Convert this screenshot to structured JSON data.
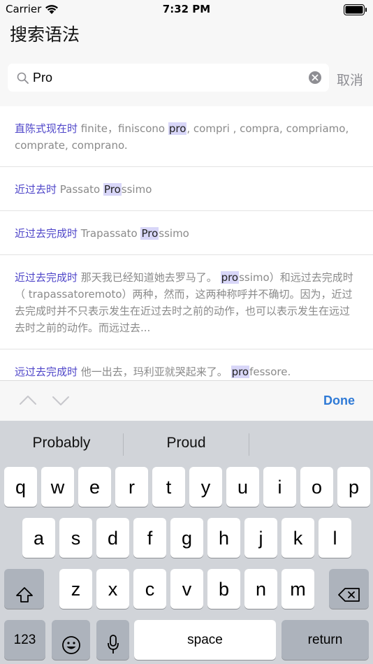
{
  "status": {
    "carrier": "Carrier",
    "time": "7:32 PM"
  },
  "nav": {
    "title": "搜索语法"
  },
  "search": {
    "value": "Pro",
    "cancel_label": "取消"
  },
  "results": [
    {
      "term": "直陈式现在时",
      "before": " finite，finiscono ",
      "match": "pro",
      "after": ", compri , compra, compriamo, comprate, comprano."
    },
    {
      "term": "近过去时",
      "before": " Passato ",
      "match": "Pro",
      "after": "ssimo"
    },
    {
      "term": "近过去完成时",
      "before": " Trapassato ",
      "match": "Pro",
      "after": "ssimo"
    },
    {
      "term": "近过去完成时",
      "before": " 那天我已经知道她去罗马了。 ",
      "match": "pro",
      "after": "ssimo）和远过去完成时（ trapassatoremoto）两种，然而，这两种称呼并不确切。因为，近过去完成时并不只表示发生在近过去时之前的动作，也可以表示发生在远过去时之前的动作。而远过去..."
    },
    {
      "term": "远过去完成时",
      "before": " 他一出去，玛利亚就哭起来了。 ",
      "match": "pro",
      "after": "fessore."
    }
  ],
  "toolbar": {
    "done_label": "Done"
  },
  "keyboard": {
    "suggestions": [
      "Probably",
      "Proud",
      ""
    ],
    "row1": [
      "q",
      "w",
      "e",
      "r",
      "t",
      "y",
      "u",
      "i",
      "o",
      "p"
    ],
    "row2": [
      "a",
      "s",
      "d",
      "f",
      "g",
      "h",
      "j",
      "k",
      "l"
    ],
    "row3": [
      "z",
      "x",
      "c",
      "v",
      "b",
      "n",
      "m"
    ],
    "numbers_label": "123",
    "space_label": "space",
    "return_label": "return"
  },
  "colors": {
    "accent": "#4f46c9",
    "highlight": "#d8d6f8",
    "done": "#2f7ad6"
  },
  "icons": [
    "wifi-icon",
    "battery-icon",
    "search-icon",
    "clear-icon",
    "chevron-up-icon",
    "chevron-down-icon",
    "shift-icon",
    "delete-icon",
    "emoji-icon",
    "microphone-icon"
  ]
}
